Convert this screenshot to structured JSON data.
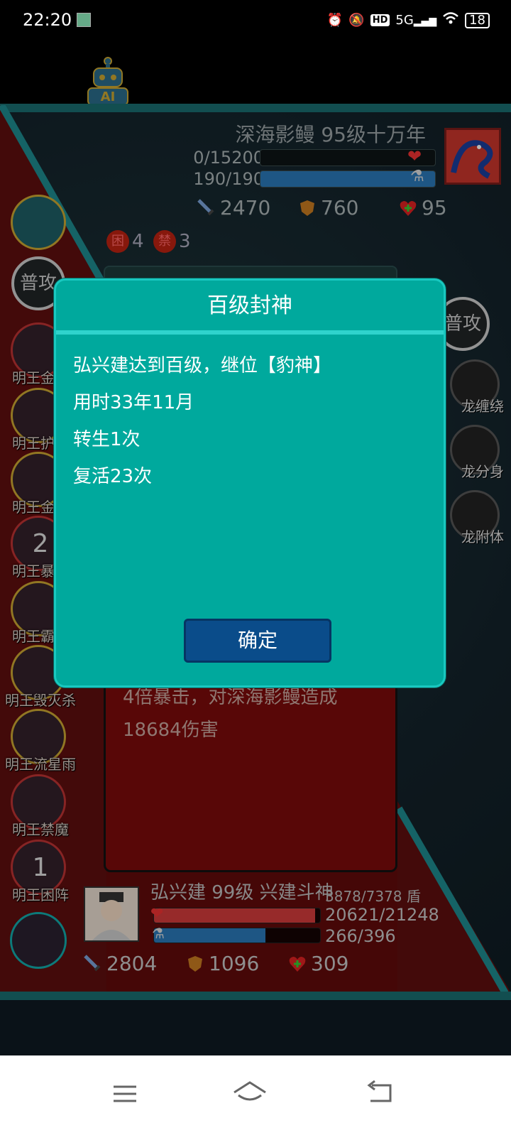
{
  "status_bar": {
    "time": "22:20",
    "network": "5G",
    "hd": "HD",
    "battery": "18",
    "icons": [
      "alarm-icon",
      "mute-icon",
      "hd-icon",
      "signal-icon",
      "wifi-icon",
      "battery-icon"
    ]
  },
  "ai_button": {
    "label": "AI"
  },
  "enemy": {
    "name": "深海影鳗 95级十万年",
    "hp": "0/15200",
    "mp": "190/190",
    "hp_fraction": 0.0,
    "mp_fraction": 1.0,
    "attack": "2470",
    "defense": "760",
    "vitality": "95",
    "effects": [
      {
        "icon": "困",
        "count": "4"
      },
      {
        "icon": "禁",
        "count": "3"
      }
    ]
  },
  "left_skills": {
    "normal_attack": "普攻",
    "items": [
      {
        "label": "明王金刚",
        "count": ""
      },
      {
        "label": "明王护身",
        "count": ""
      },
      {
        "label": "明王金身",
        "count": ""
      },
      {
        "label": "明王暴击",
        "count": "2"
      },
      {
        "label": "明王霸体",
        "count": ""
      },
      {
        "label": "明王毁灭杀",
        "count": ""
      },
      {
        "label": "明王流星雨",
        "count": ""
      },
      {
        "label": "明王禁魔",
        "count": ""
      },
      {
        "label": "明王困阵",
        "count": "1"
      }
    ]
  },
  "right_skills": {
    "normal_attack": "普攻",
    "items": [
      {
        "label": "龙缠绕"
      },
      {
        "label": "龙分身"
      },
      {
        "label": "龙附体"
      }
    ]
  },
  "battle_log": {
    "text": "4倍暴击，对深海影鳗造成18684伤害"
  },
  "player": {
    "name": "弘兴建 99级 兴建斗神",
    "shield": "3878/7378 盾",
    "hp": "20621/21248",
    "mp": "266/396",
    "hp_fraction": 0.97,
    "mp_fraction": 0.67,
    "attack": "2804",
    "defense": "1096",
    "vitality": "309"
  },
  "modal": {
    "title": "百级封神",
    "lines": [
      "弘兴建达到百级，继位【豹神】",
      "用时33年11月",
      "转生1次",
      "复活23次"
    ],
    "confirm_label": "确定"
  },
  "colors": {
    "modal_bg": "#00a99d",
    "modal_header_line": "#2fd3cc",
    "confirm_bg": "#0a4c8a",
    "battle_border": "#1a6d70",
    "red_zone": "#7b0b0b"
  },
  "nav": {
    "icons": [
      "menu-icon",
      "home-icon",
      "back-icon"
    ]
  }
}
